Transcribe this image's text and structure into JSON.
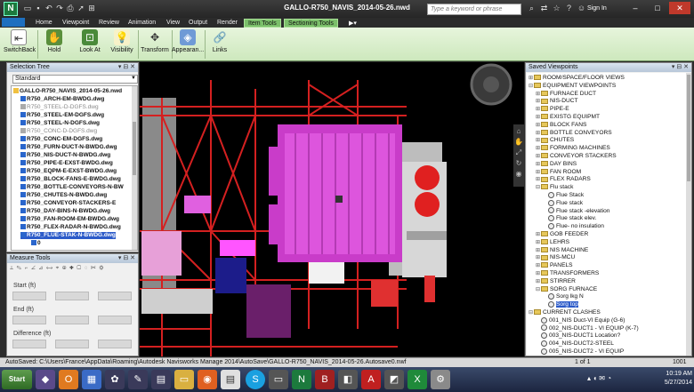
{
  "app": {
    "title": "GALLO-R750_NAVIS_2014-05-26.nwd",
    "logo": "N",
    "quick_access": [
      "open-icon",
      "save-icon",
      "undo-icon",
      "redo-icon",
      "print-icon",
      "select-icon",
      "measure-icon"
    ],
    "search_placeholder": "Type a keyword or phrase",
    "sign_in": "Sign In"
  },
  "tabs": [
    {
      "label": "Home"
    },
    {
      "label": "Viewpoint"
    },
    {
      "label": "Review"
    },
    {
      "label": "Animation"
    },
    {
      "label": "View"
    },
    {
      "label": "Output"
    },
    {
      "label": "Render"
    },
    {
      "label": "Item Tools"
    },
    {
      "label": "Sectioning Tools"
    }
  ],
  "ribbon": [
    {
      "label": "SwitchBack"
    },
    {
      "label": "Hold"
    },
    {
      "label": "Look At"
    },
    {
      "label": "Visibility"
    },
    {
      "label": "Transform"
    },
    {
      "label": "Appearan..."
    },
    {
      "label": "Links"
    }
  ],
  "selection_tree": {
    "title": "Selection Tree",
    "mode": "Standard",
    "items": [
      {
        "text": "GALLO-R750_NAVIS_2014-05-26.nwd",
        "style": "root"
      },
      {
        "text": "R750_ARCH-EM-BWDG.dwg",
        "style": "bold"
      },
      {
        "text": "R750_STEEL-D-DGFS.dwg",
        "style": "gray"
      },
      {
        "text": "R750_STEEL-EM-DGFS.dwg",
        "style": "bold"
      },
      {
        "text": "R750_STEEL-N-DGFS.dwg",
        "style": "bold"
      },
      {
        "text": "R750_CONC-D-DGFS.dwg",
        "style": "gray"
      },
      {
        "text": "R750_CONC-EM-DGFS.dwg",
        "style": "bold"
      },
      {
        "text": "R750_FURN-DUCT-N-BWDG.dwg",
        "style": "bold"
      },
      {
        "text": "R750_NIS-DUCT-N-BWDG.dwg",
        "style": "bold"
      },
      {
        "text": "R750_PIPE-E-EXST-BWDG.dwg",
        "style": "bold"
      },
      {
        "text": "R750_EQPM-E-EXST-BWDG.dwg",
        "style": "bold"
      },
      {
        "text": "R750_BLOCK-FANS-E-BWDG.dwg",
        "style": "bold"
      },
      {
        "text": "R750_BOTTLE-CONVEYORS-N-BW",
        "style": "bold"
      },
      {
        "text": "R750_CHUTES-N-BWDG.dwg",
        "style": "bold"
      },
      {
        "text": "R750_CONVEYOR-STACKERS-E",
        "style": "bold"
      },
      {
        "text": "R750_DAY-BINS-N-BWDG.dwg",
        "style": "bold"
      },
      {
        "text": "R750_FAN-ROOM-EM-BWDG.dwg",
        "style": "bold"
      },
      {
        "text": "R750_FLEX-RADAR-N-BWDG.dwg",
        "style": "bold"
      },
      {
        "text": "R750_FLUE-STAK-N-BWDG.dwg",
        "style": "sel"
      },
      {
        "text": "0",
        "style": "child"
      }
    ]
  },
  "measure": {
    "title": "Measure Tools",
    "start": "Start (ft)",
    "end": "End (ft)",
    "difference": "Difference (ft)"
  },
  "saved_viewpoints": {
    "title": "Saved Viewpoints",
    "items": [
      {
        "text": "ROOM/SPACE/FLOOR VIEWS",
        "kind": "folder",
        "level": 1,
        "exp": "+"
      },
      {
        "text": "EQUIPMENT VIEWPOINTS",
        "kind": "folder",
        "level": 1,
        "exp": "-"
      },
      {
        "text": "FURNACE DUCT",
        "kind": "folder",
        "level": 2,
        "exp": "+"
      },
      {
        "text": "NIS-DUCT",
        "kind": "folder",
        "level": 2,
        "exp": "+"
      },
      {
        "text": "PIPE-E",
        "kind": "folder",
        "level": 2,
        "exp": "+"
      },
      {
        "text": "EXISTG EQUIPMT",
        "kind": "folder",
        "level": 2,
        "exp": "+"
      },
      {
        "text": "BLOCK FANS",
        "kind": "folder",
        "level": 2,
        "exp": "+"
      },
      {
        "text": "BOTTLE CONVEYORS",
        "kind": "folder",
        "level": 2,
        "exp": "+"
      },
      {
        "text": "CHUTES",
        "kind": "folder",
        "level": 2,
        "exp": "+"
      },
      {
        "text": "FORMING MACHINES",
        "kind": "folder",
        "level": 2,
        "exp": "+"
      },
      {
        "text": "CONVEYOR STACKERS",
        "kind": "folder",
        "level": 2,
        "exp": "+"
      },
      {
        "text": "DAY BINS",
        "kind": "folder",
        "level": 2,
        "exp": "+"
      },
      {
        "text": "FAN ROOM",
        "kind": "folder",
        "level": 2,
        "exp": "+"
      },
      {
        "text": "FLEX RADARS",
        "kind": "folder",
        "level": 2,
        "exp": "+"
      },
      {
        "text": "Flu stack",
        "kind": "folder",
        "level": 2,
        "exp": "-"
      },
      {
        "text": "Flue Stack",
        "kind": "view",
        "level": 3,
        "exp": ""
      },
      {
        "text": "Flue stack",
        "kind": "view",
        "level": 3,
        "exp": ""
      },
      {
        "text": "Flue stack -elevation",
        "kind": "view",
        "level": 3,
        "exp": ""
      },
      {
        "text": "Flue stack elev.",
        "kind": "view",
        "level": 3,
        "exp": ""
      },
      {
        "text": "Flue- no insulation",
        "kind": "view",
        "level": 3,
        "exp": ""
      },
      {
        "text": "GOB FEEDER",
        "kind": "folder",
        "level": 2,
        "exp": "+"
      },
      {
        "text": "LEHRS",
        "kind": "folder",
        "level": 2,
        "exp": "+"
      },
      {
        "text": "NIS MACHINE",
        "kind": "folder",
        "level": 2,
        "exp": "+"
      },
      {
        "text": "NIS-MCU",
        "kind": "folder",
        "level": 2,
        "exp": "+"
      },
      {
        "text": "PANELS",
        "kind": "folder",
        "level": 2,
        "exp": "+"
      },
      {
        "text": "TRANSFORMERS",
        "kind": "folder",
        "level": 2,
        "exp": "+"
      },
      {
        "text": "STIRRER",
        "kind": "folder",
        "level": 2,
        "exp": "+"
      },
      {
        "text": "SORG FURNACE",
        "kind": "folder",
        "level": 2,
        "exp": "-"
      },
      {
        "text": "Sorg lkg N",
        "kind": "view",
        "level": 3,
        "exp": ""
      },
      {
        "text": "Sorg top",
        "kind": "view",
        "level": 3,
        "exp": "",
        "selected": true
      },
      {
        "text": "CURRENT CLASHES",
        "kind": "folder",
        "level": 1,
        "exp": "-"
      },
      {
        "text": "001_NIS Duct-VI Equip (G-6)",
        "kind": "view",
        "level": 2,
        "exp": ""
      },
      {
        "text": "002_NIS-DUCT1 - VI EQUIP (K-7)",
        "kind": "view",
        "level": 2,
        "exp": ""
      },
      {
        "text": "003_NIS-DUCT1 Location?",
        "kind": "view",
        "level": 2,
        "exp": ""
      },
      {
        "text": "004_NIS-DUCT2-STEEL",
        "kind": "view",
        "level": 2,
        "exp": ""
      },
      {
        "text": "005_NIS-DUCT2 - VI EQUIP",
        "kind": "view",
        "level": 2,
        "exp": ""
      }
    ]
  },
  "status": {
    "text": "AutoSaved: C:\\Users\\France\\AppData\\Roaming\\Autodesk Navisworks Manage 2014\\AutoSave\\GALLO-R750_NAVIS_2014-05-26.Autosave0.nwf",
    "page": "1 of 1",
    "memory": "1001"
  },
  "taskbar": {
    "start": "Start",
    "time": "10:19 AM",
    "date": "5/27/2014"
  },
  "colors": {
    "ribbon": "#d6eec8",
    "magenta": "#cc33cc",
    "steel_red": "#d42020",
    "selection": "#2c5bc9"
  }
}
